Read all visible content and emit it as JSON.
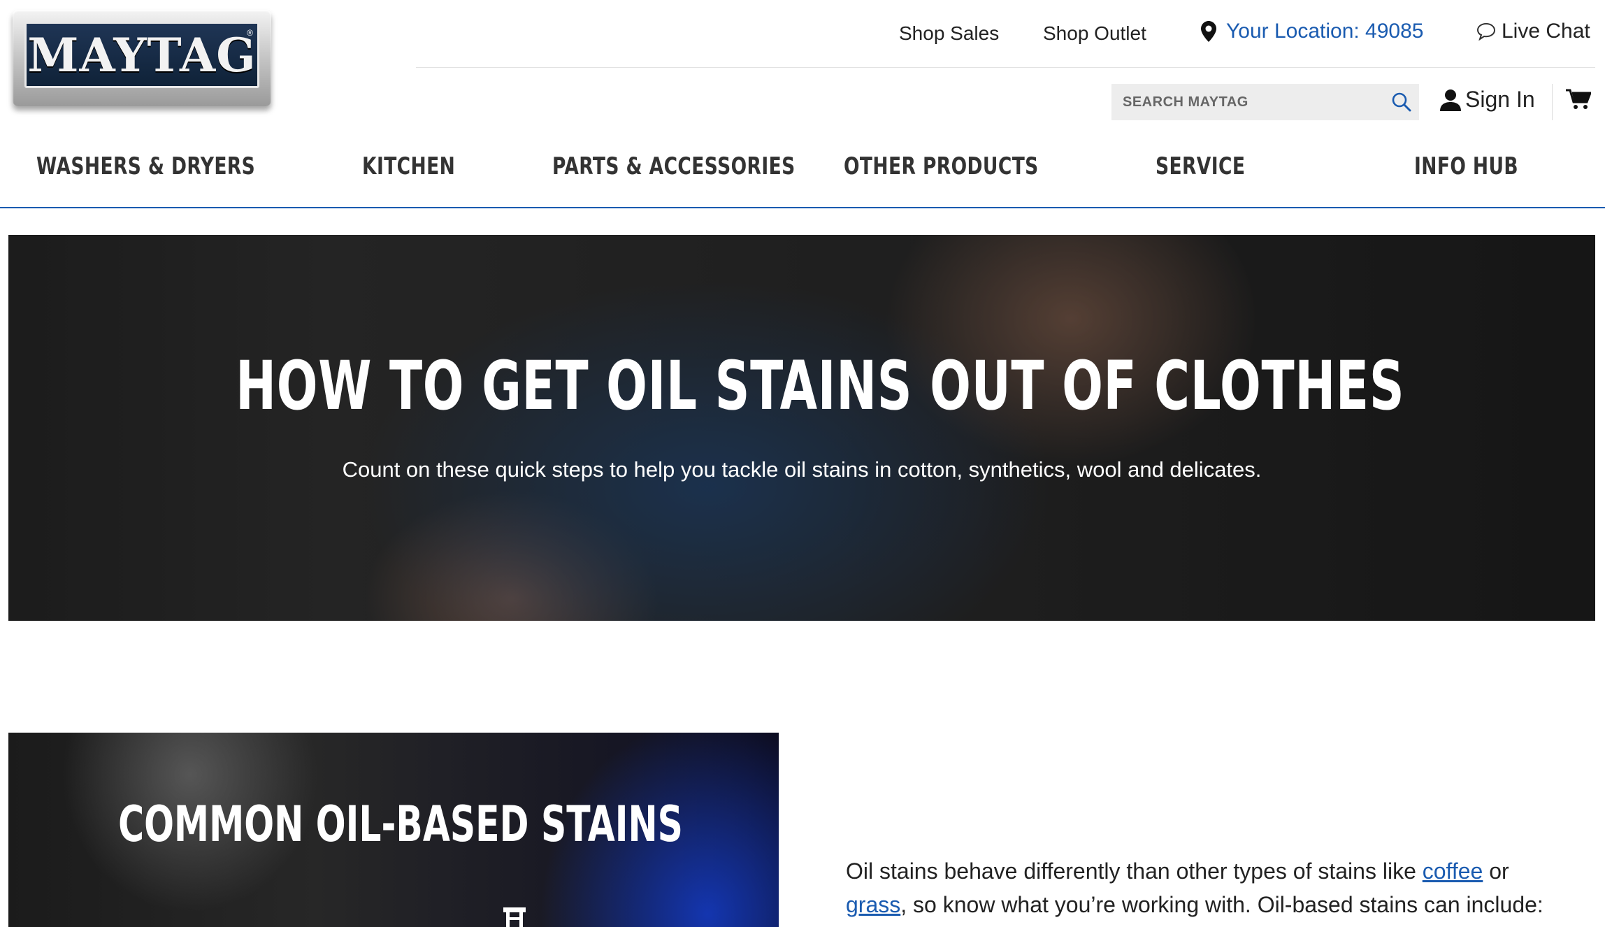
{
  "brand": {
    "logo_text": "MAYTAG",
    "reg_mark": "®"
  },
  "top_links": {
    "shop_sales": "Shop Sales",
    "shop_outlet": "Shop Outlet",
    "location": "Your Location: 49085",
    "live_chat": "Live Chat"
  },
  "search": {
    "placeholder": "SEARCH MAYTAG",
    "value": ""
  },
  "account": {
    "sign_in": "Sign In"
  },
  "nav": {
    "items": [
      "WASHERS & DRYERS",
      "KITCHEN",
      "PARTS & ACCESSORIES",
      "OTHER PRODUCTS",
      "SERVICE",
      "INFO HUB"
    ]
  },
  "hero": {
    "title": "HOW TO GET OIL STAINS OUT OF CLOTHES",
    "subtitle": "Count on these quick steps to help you tackle oil stains in cotton, synthetics, wool and delicates."
  },
  "section": {
    "card_title": "COMMON OIL-BASED STAINS",
    "text_pre": "Oil stains behave differently than other types of stains like ",
    "link_coffee": "coffee",
    "text_mid": " or ",
    "link_grass": "grass",
    "text_post": ", so know what you’re working with. Oil-based stains can include:"
  },
  "colors": {
    "accent": "#1a5bb0",
    "nav_text": "#333333"
  },
  "icons": [
    "location-pin-icon",
    "chat-bubble-icon",
    "search-icon",
    "user-icon",
    "cart-icon",
    "stain-item-icon"
  ]
}
